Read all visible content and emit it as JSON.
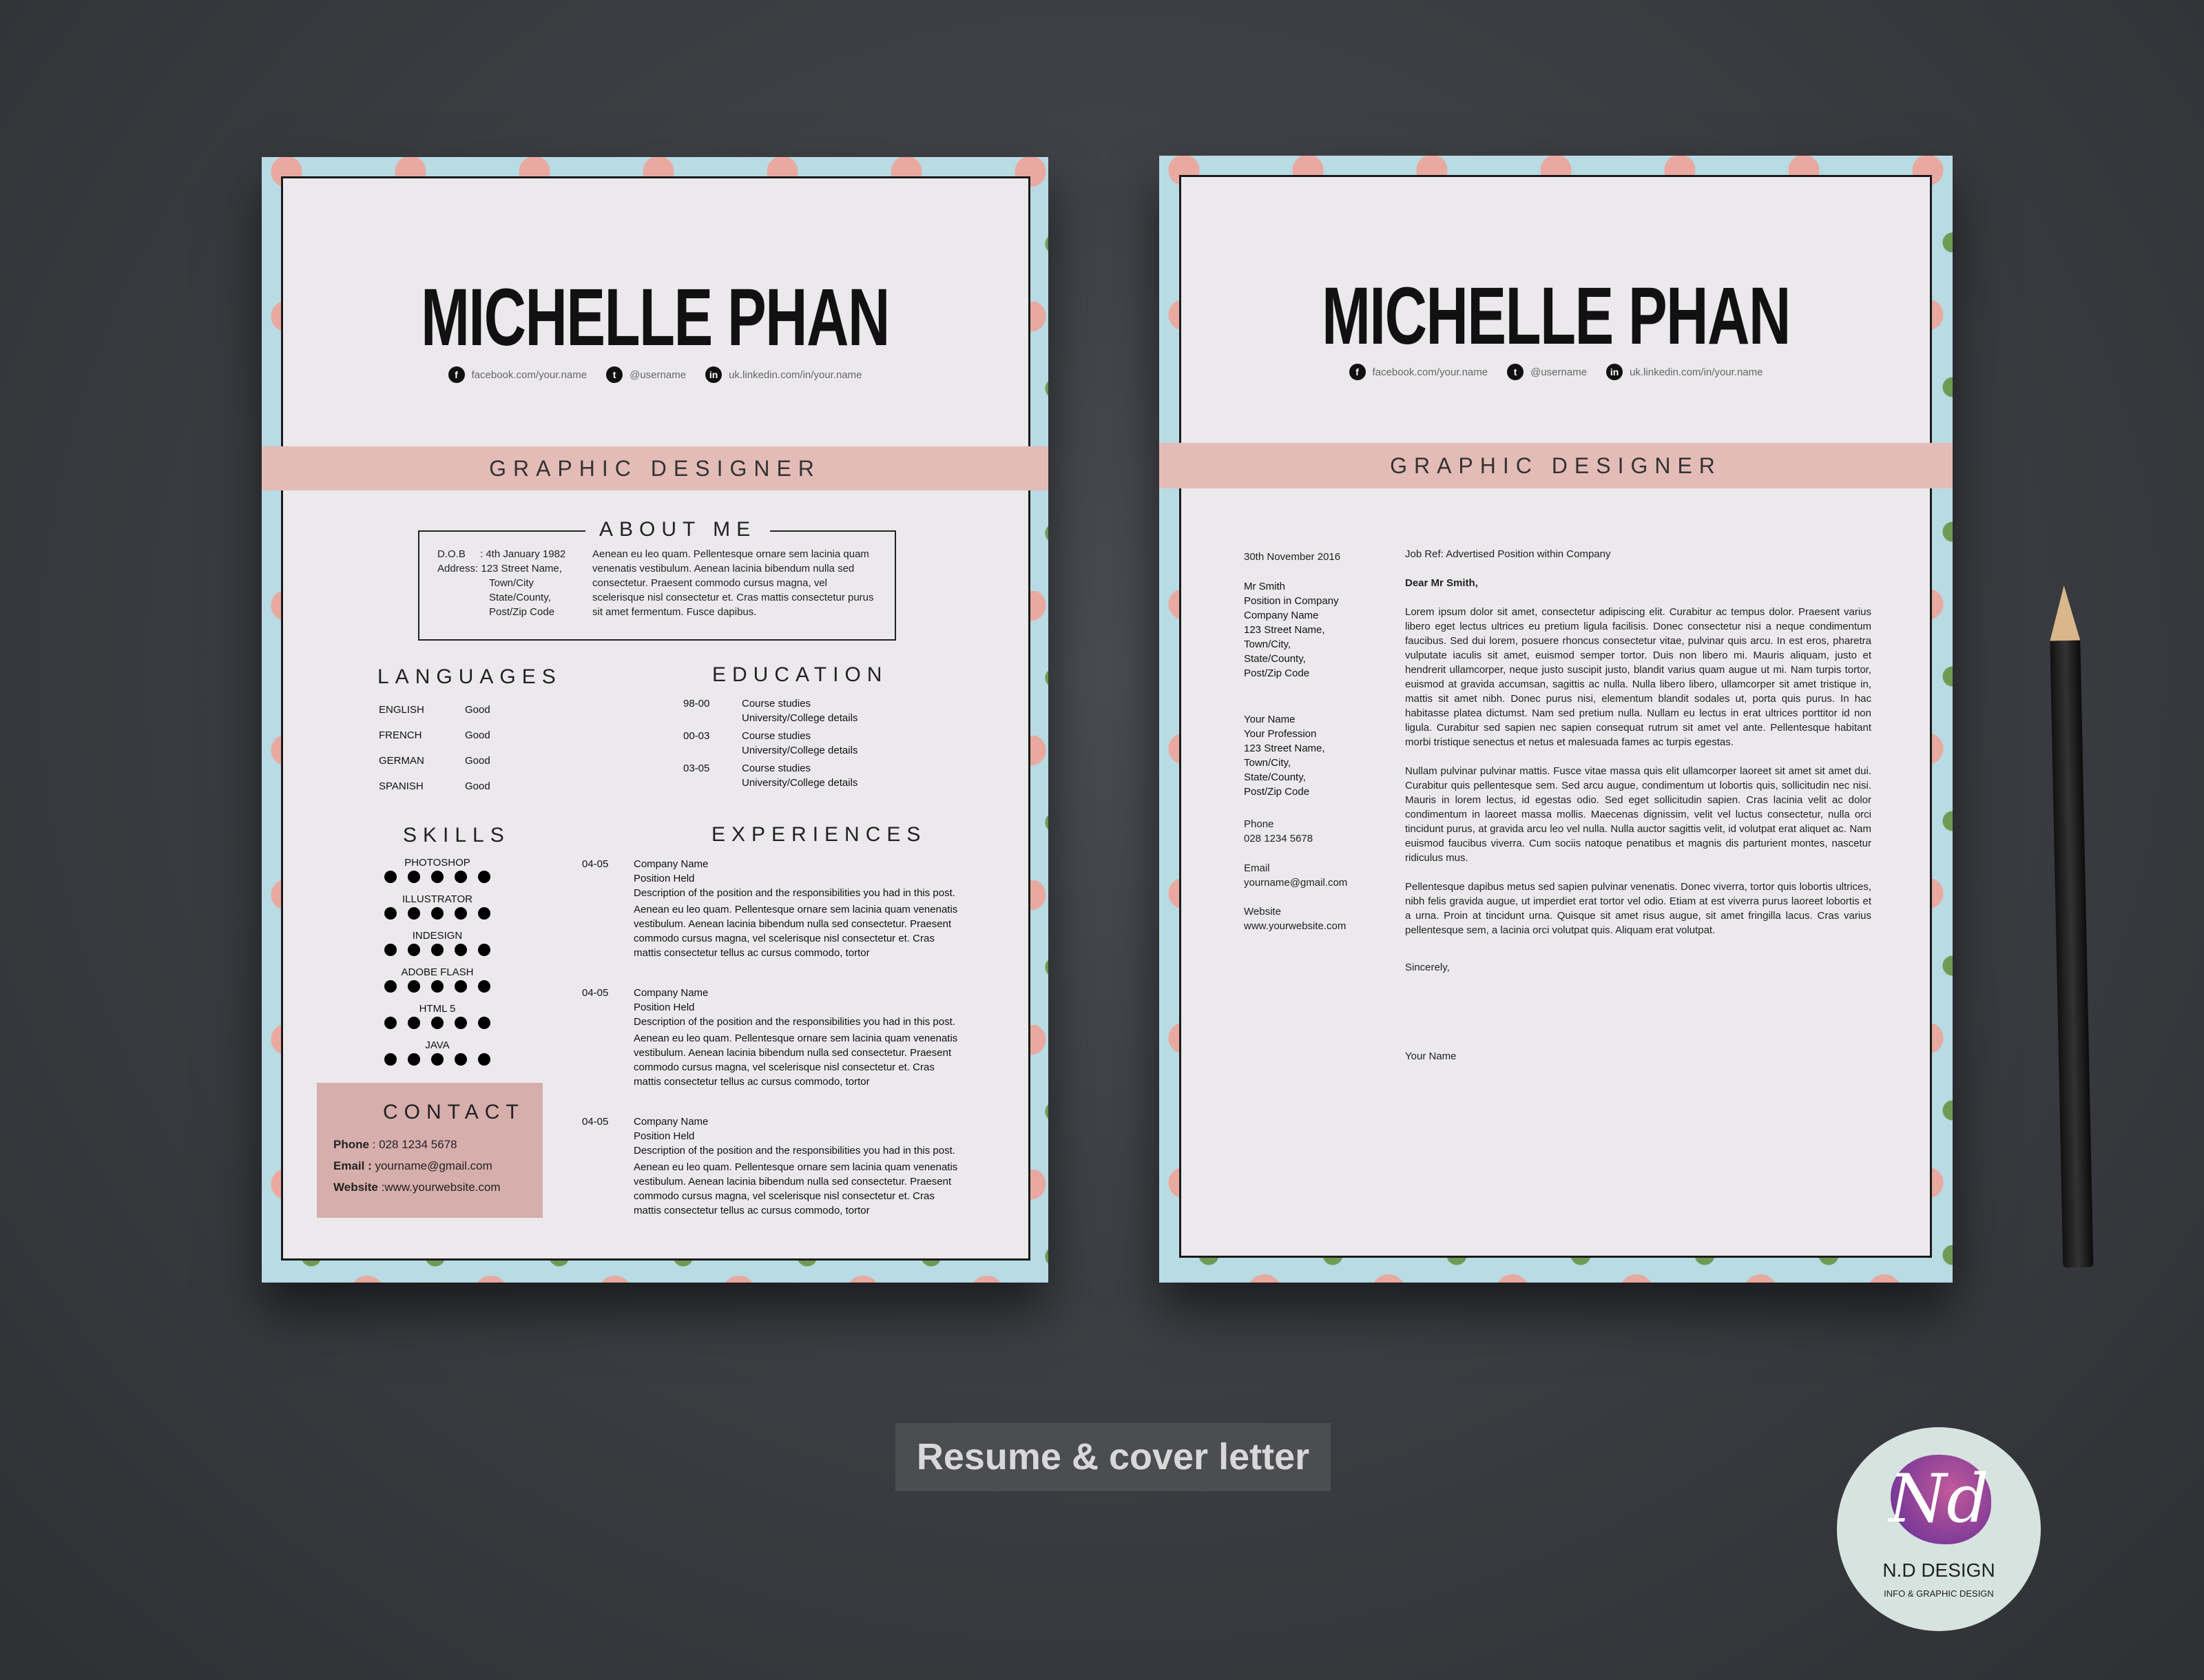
{
  "resume": {
    "name": "MICHELLE PHAN",
    "social": [
      {
        "icon": "facebook-icon",
        "glyph": "f",
        "text": "facebook.com/your.name"
      },
      {
        "icon": "twitter-icon",
        "glyph": "t",
        "text": "@username"
      },
      {
        "icon": "linkedin-icon",
        "glyph": "in",
        "text": "uk.linkedin.com/in/your.name"
      }
    ],
    "title": "GRAPHIC DESIGNER",
    "about": {
      "heading": "ABOUT ME",
      "dob_label": "D.O.B",
      "dob": ": 4th January 1982",
      "address_label": "Address",
      "address": [
        ": 123 Street Name,",
        "Town/City",
        "State/County,",
        "Post/Zip Code"
      ],
      "text": "Aenean eu leo quam. Pellentesque ornare sem lacinia quam venenatis vestibulum. Aenean lacinia bibendum nulla sed consectetur. Praesent commodo cursus magna, vel scelerisque nisl consectetur et. Cras mattis consectetur purus sit amet fermentum. Fusce dapibus."
    },
    "languages": {
      "heading": "LANGUAGES",
      "items": [
        {
          "lang": "ENGLISH",
          "level": "Good"
        },
        {
          "lang": "FRENCH",
          "level": "Good"
        },
        {
          "lang": "GERMAN",
          "level": "Good"
        },
        {
          "lang": "SPANISH",
          "level": "Good"
        }
      ]
    },
    "education": {
      "heading": "EDUCATION",
      "items": [
        {
          "years": "98-00",
          "line1": "Course studies",
          "line2": "University/College details"
        },
        {
          "years": "00-03",
          "line1": "Course studies",
          "line2": "University/College details"
        },
        {
          "years": "03-05",
          "line1": "Course studies",
          "line2": "University/College details"
        }
      ]
    },
    "skills": {
      "heading": "SKILLS",
      "items": [
        {
          "name": "PHOTOSHOP",
          "level": 5,
          "max": 5
        },
        {
          "name": "ILLUSTRATOR",
          "level": 5,
          "max": 5
        },
        {
          "name": "INDESIGN",
          "level": 5,
          "max": 5
        },
        {
          "name": "ADOBE FLASH",
          "level": 5,
          "max": 5
        },
        {
          "name": "HTML 5",
          "level": 5,
          "max": 5
        },
        {
          "name": "JAVA",
          "level": 5,
          "max": 5
        }
      ]
    },
    "experiences": {
      "heading": "EXPERIENCES",
      "items": [
        {
          "years": "04-05",
          "company": "Company Name",
          "position": "Position Held",
          "summary": "Description of the position and the responsibilities you had in this post.",
          "text": "Aenean eu leo quam. Pellentesque ornare sem lacinia quam venenatis vestibulum. Aenean lacinia bibendum nulla sed consectetur. Praesent commodo cursus magna, vel scelerisque nisl consectetur et. Cras mattis consectetur tellus ac cursus commodo, tortor"
        },
        {
          "years": "04-05",
          "company": "Company Name",
          "position": "Position Held",
          "summary": "Description of the position and the responsibilities you had in this post.",
          "text": "Aenean eu leo quam. Pellentesque ornare sem lacinia quam venenatis vestibulum. Aenean lacinia bibendum nulla sed consectetur. Praesent commodo cursus magna, vel scelerisque nisl consectetur et. Cras mattis consectetur tellus ac cursus commodo, tortor"
        },
        {
          "years": "04-05",
          "company": "Company Name",
          "position": "Position Held",
          "summary": "Description of the position and the responsibilities you had in this post.",
          "text": "Aenean eu leo quam. Pellentesque ornare sem lacinia quam venenatis vestibulum. Aenean lacinia bibendum nulla sed consectetur. Praesent commodo cursus magna, vel scelerisque nisl consectetur et. Cras mattis consectetur tellus ac cursus commodo, tortor"
        }
      ]
    },
    "contact": {
      "heading": "CONTACT",
      "phone_label": "Phone",
      "phone": " : 028 1234 5678",
      "email_label": "Email :",
      "email": " yourname@gmail.com",
      "website_label": "Website",
      "website": " :www.yourwebsite.com"
    }
  },
  "cover": {
    "name": "MICHELLE PHAN",
    "title": "GRAPHIC DESIGNER",
    "date": "30th November 2016",
    "recipient": [
      "Mr Smith",
      "Position in Company",
      "Company Name",
      "123 Street Name,",
      "Town/City,",
      "State/County,",
      "Post/Zip Code"
    ],
    "sender": [
      "Your Name",
      "Your Profession",
      "123 Street Name,",
      "Town/City,",
      "State/County,",
      "Post/Zip Code"
    ],
    "phone_label": "Phone",
    "phone": "028 1234 5678",
    "email_label": "Email",
    "email": "yourname@gmail.com",
    "website_label": "Website",
    "website": "www.yourwebsite.com",
    "job_ref": "Job Ref: Advertised Position within Company",
    "salutation": "Dear Mr Smith,",
    "paragraphs": [
      "Lorem ipsum dolor sit amet, consectetur adipiscing elit. Curabitur ac tempus dolor. Praesent varius libero eget lectus ultrices eu pretium ligula facilisis. Donec consectetur nisi a neque condimentum faucibus. Sed dui lorem, posuere rhoncus consectetur vitae, pulvinar quis arcu. In est eros, pharetra vulputate iaculis sit amet, euismod semper tortor. Duis non libero mi. Mauris aliquam, justo et hendrerit ullamcorper, neque justo suscipit justo, blandit varius quam augue ut mi. Nam turpis tortor, euismod at gravida accumsan, sagittis ac nulla. Nulla libero libero, ullamcorper sit amet tristique in, mattis sit amet nibh. Donec purus nisi, elementum blandit sodales ut, porta quis purus. In hac habitasse platea dictumst. Nam sed pretium nulla. Nullam eu lectus in erat ultrices porttitor id non ligula. Curabitur sed sapien nec sapien consequat rutrum sit amet vel ante. Pellentesque habitant morbi tristique senectus et netus et malesuada fames ac turpis egestas.",
      "Nullam pulvinar pulvinar mattis. Fusce vitae massa quis elit ullamcorper laoreet sit amet sit amet dui. Curabitur quis pellentesque sem. Sed arcu augue, condimentum ut lobortis quis, sollicitudin nec nisi. Mauris in lorem lectus, id egestas odio. Sed eget sollicitudin sapien. Cras lacinia velit ac dolor condimentum in laoreet massa mollis. Maecenas dignissim, velit vel luctus consectetur, nulla orci tincidunt purus, at gravida arcu leo vel nulla. Nulla auctor sagittis velit, id volutpat erat aliquet ac. Nam euismod faucibus viverra. Cum sociis natoque penatibus et magnis dis parturient montes, nascetur ridiculus mus.",
      "Pellentesque dapibus metus sed sapien pulvinar venenatis. Donec viverra, tortor quis lobortis ultrices, nibh felis gravida augue, ut imperdiet erat tortor vel odio. Etiam at est viverra purus laoreet lobortis et a urna. Proin at tincidunt urna. Quisque sit amet risus augue, sit amet fringilla lacus. Cras varius pellentesque sem, a lacinia orci volutpat quis. Aliquam erat volutpat."
    ],
    "closing": "Sincerely,",
    "signature": "Your Name"
  },
  "caption": "Resume & cover letter",
  "badge": {
    "monogram": "Nd",
    "name": "N.D DESIGN",
    "tagline": "INFO & GRAPHIC DESIGN"
  },
  "colors": {
    "accent_pink": "#e4bcb7",
    "contact_pink": "#d6aeab",
    "floral_blue": "#b9dbe3",
    "background": "#3d3f44"
  }
}
